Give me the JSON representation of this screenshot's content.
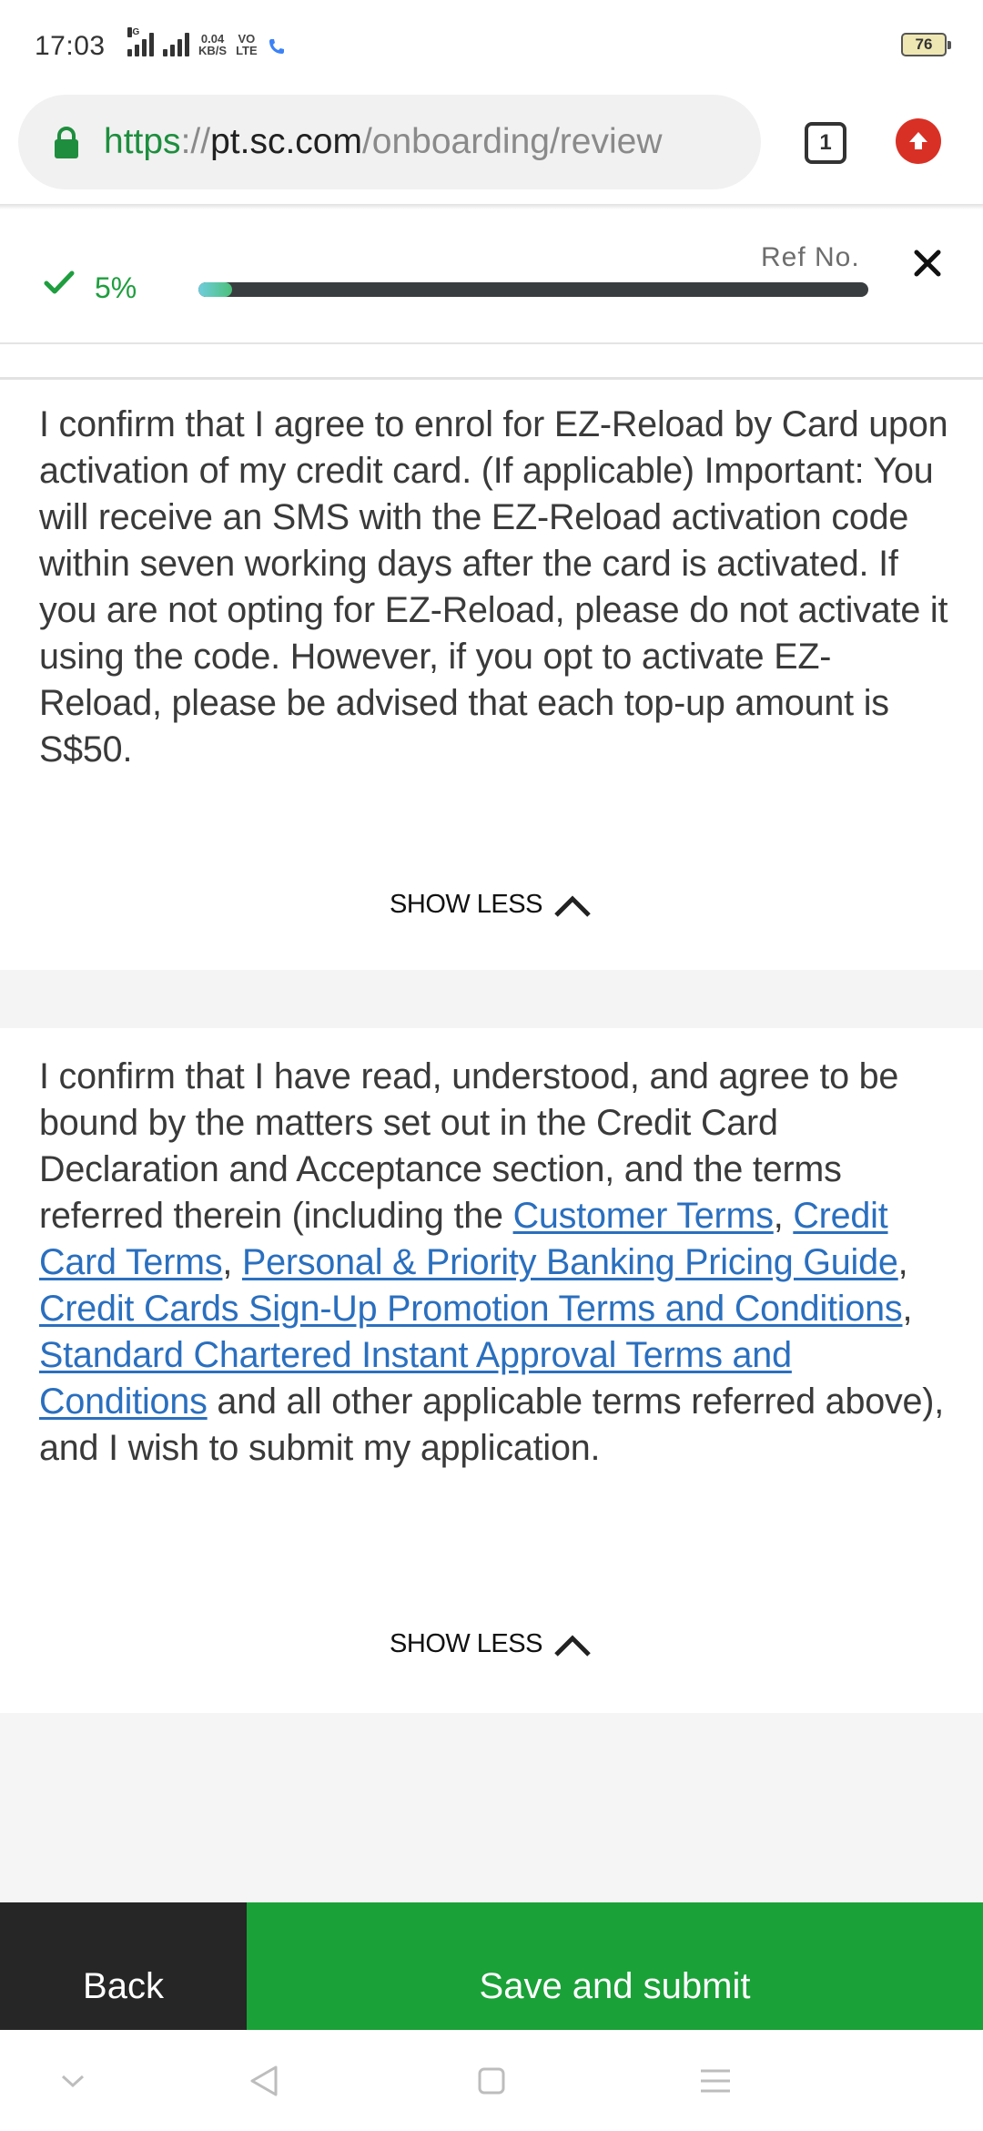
{
  "status_bar": {
    "time": "17:03",
    "network_type": "4G",
    "speed_value": "0.04",
    "speed_unit": "KB/S",
    "volte_top": "VO",
    "volte_bottom": "LTE",
    "battery": "76"
  },
  "browser": {
    "url_scheme": "https",
    "url_sep": "://",
    "url_host": "pt.sc.com",
    "url_path": "/onboarding/review",
    "tab_count": "1",
    "icons": {
      "lock": "lock-icon",
      "update": "update-arrow-icon"
    }
  },
  "progress": {
    "percent_label": "5%",
    "percent_value": 5,
    "ref_label": "Ref No.",
    "accent_color": "#1e9e3e"
  },
  "sections": [
    {
      "text": "I confirm that I agree to enrol for EZ-Reload by Card upon activation of my credit card. (If applicable) Important: You will receive an SMS with the EZ-Reload activation code within seven working days after the card is activated. If you are not opting for EZ-Reload, please do not activate it using the code. However, if you opt to activate EZ-Reload, please be advised that each top-up amount is S$50.",
      "toggle_label": "SHOW LESS"
    },
    {
      "text_before": "I confirm that I have read, understood, and agree to be bound by the matters set out in the Credit Card Declaration and Acceptance section, and the terms referred therein (including the ",
      "links": [
        "Customer Terms",
        "Credit Card Terms",
        "Personal & Priority Banking Pricing Guide",
        "Credit Cards Sign-Up Promotion Terms and Conditions",
        "Standard Chartered Instant Approval Terms and Conditions"
      ],
      "separator": ", ",
      "text_after": " and all other applicable terms referred above), and I wish to submit my application.",
      "toggle_label": "SHOW LESS"
    }
  ],
  "actions": {
    "back_label": "Back",
    "submit_label": "Save and submit",
    "submit_color": "#1aa138",
    "back_color": "#262626"
  },
  "nav": {
    "icons": [
      "chevron-down-icon",
      "back-triangle-icon",
      "home-square-icon",
      "menu-lines-icon"
    ]
  }
}
